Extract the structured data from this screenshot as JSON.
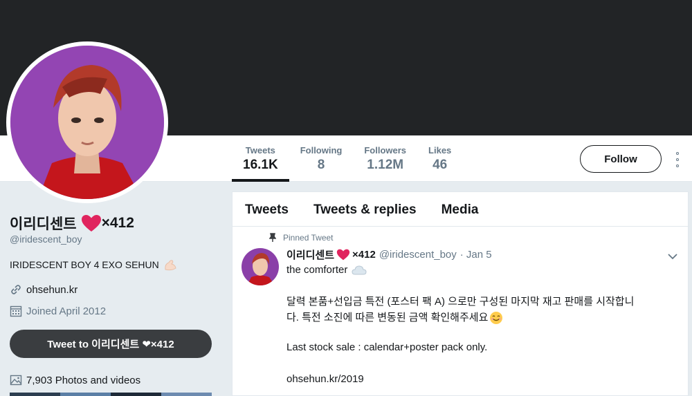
{
  "profile": {
    "name": "이리디센트",
    "name_suffix": "×412",
    "handle": "@iridescent_boy",
    "bio": "IRIDESCENT BOY 4 EXO SEHUN",
    "website": "ohsehun.kr",
    "joined": "Joined April 2012",
    "tweet_to": "Tweet to 이리디센트 ❤×412",
    "photos": "7,903 Photos and videos"
  },
  "stats": [
    {
      "label": "Tweets",
      "value": "16.1K"
    },
    {
      "label": "Following",
      "value": "8"
    },
    {
      "label": "Followers",
      "value": "1.12M"
    },
    {
      "label": "Likes",
      "value": "46"
    }
  ],
  "follow_label": "Follow",
  "tabs": [
    "Tweets",
    "Tweets & replies",
    "Media"
  ],
  "tweet": {
    "pinned_label": "Pinned Tweet",
    "name": "이리디센트",
    "name_suffix": "×412",
    "handle": "@iridescent_boy",
    "date": "· Jan 5",
    "line1": "the comforter",
    "para1_a": "달력 본품+선입금 특전 (포스터 팩 A) 으로만 구성된 마지막 재고 판매를 시작합니",
    "para1_b": "다. 특전 소진에 따른 변동된 금액 확인해주세요",
    "para2": "Last stock sale : calendar+poster pack only.",
    "para3": "ohsehun.kr/2019"
  },
  "colors": {
    "banner": "#222426",
    "heart": "#e0245e",
    "muted": "#657786",
    "avatar_bg": "#8a3fa8"
  },
  "icons": [
    "heart-icon",
    "link-icon",
    "calendar-icon",
    "photo-icon",
    "pin-icon",
    "chevron-down-icon",
    "more-icon",
    "cloud-icon",
    "smile-icon",
    "flexed-arm-icon"
  ]
}
